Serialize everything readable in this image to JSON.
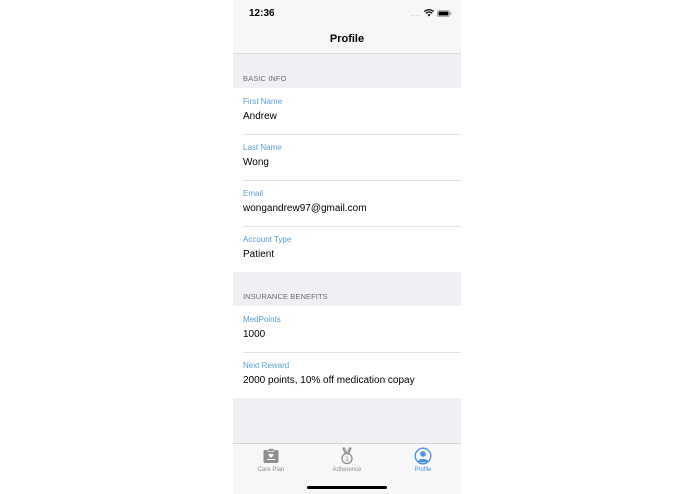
{
  "status_bar": {
    "time": "12:36",
    "signal": "....",
    "wifi_icon": "wifi-icon",
    "battery_icon": "battery-icon"
  },
  "nav": {
    "title": "Profile"
  },
  "sections": {
    "basic_info": {
      "header": "BASIC INFO",
      "fields": [
        {
          "label": "First Name",
          "value": "Andrew"
        },
        {
          "label": "Last Name",
          "value": "Wong"
        },
        {
          "label": "Email",
          "value": "wongandrew97@gmail.com"
        },
        {
          "label": "Account Type",
          "value": "Patient"
        }
      ]
    },
    "insurance": {
      "header": "INSURANCE BENEFITS",
      "fields": [
        {
          "label": "MedPoints",
          "value": "1000"
        },
        {
          "label": "Next Reward",
          "value": "2000 points, 10% off medication copay"
        }
      ]
    }
  },
  "tab_bar": {
    "tabs": [
      {
        "label": "Care Plan",
        "icon": "clipboard-icon",
        "active": false
      },
      {
        "label": "Adherence",
        "icon": "medal-icon",
        "active": false
      },
      {
        "label": "Profile",
        "icon": "profile-icon",
        "active": true
      }
    ]
  },
  "colors": {
    "field_label": "#5b9bd5",
    "active_tab": "#4a90e2",
    "inactive_tab": "#8e8e93",
    "group_background": "#efeff4"
  }
}
